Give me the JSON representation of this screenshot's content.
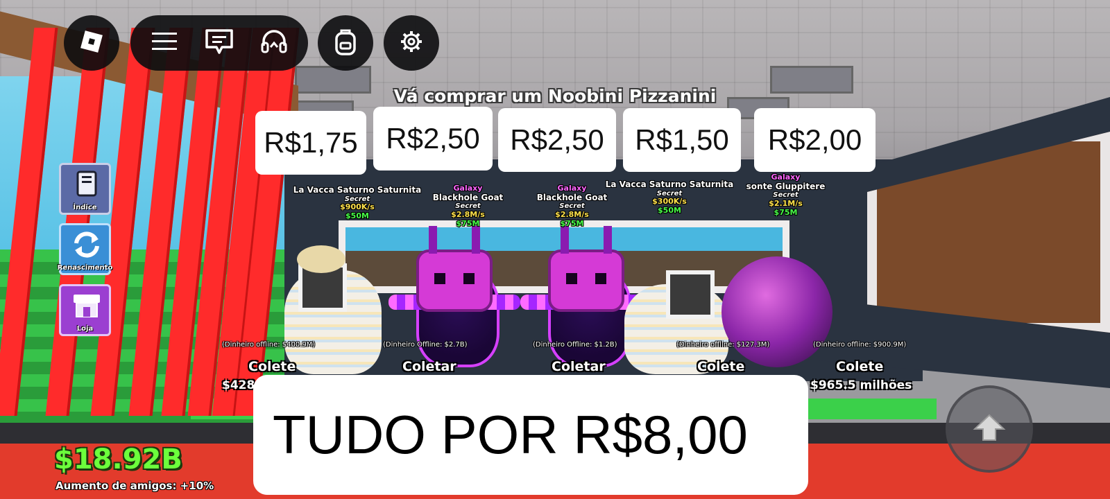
{
  "topbar": {
    "icons": [
      "roblox-logo-icon",
      "menu-icon",
      "chat-icon",
      "voice-headset-icon",
      "backpack-icon",
      "settings-gear-icon"
    ]
  },
  "side_menu": [
    {
      "label": "Índice",
      "icon": "book-icon",
      "color": "#5b6aa6"
    },
    {
      "label": "Renascimento",
      "icon": "rebirth-arrows-icon",
      "color": "#3a8fd6"
    },
    {
      "label": "Loja",
      "icon": "shop-icon",
      "color": "#9b3fd1"
    }
  ],
  "quest_text": "Vá comprar um Noobini Pizzanini",
  "price_cards": [
    "R$1,75",
    "R$2,50",
    "R$2,50",
    "R$1,50",
    "R$2,00"
  ],
  "bundle_text": "TUDO POR R$8,00",
  "brainrots": [
    {
      "rarity": "",
      "name": "La Vacca Saturno Saturnita",
      "mutation": "Secret",
      "rate": "$900K/s",
      "price": "$50M",
      "offline": "(Dinheiro offline: $400.9M)",
      "collect": "Colete",
      "amount": "$428"
    },
    {
      "rarity": "Galaxy",
      "name": "Blackhole Goat",
      "mutation": "Secret",
      "rate": "$2.8M/s",
      "price": "$75M",
      "offline": "(Dinheiro Offline: $2.7B)",
      "collect": "Coletar",
      "amount": ""
    },
    {
      "rarity": "Galaxy",
      "name": "Blackhole Goat",
      "mutation": "Secret",
      "rate": "$2.8M/s",
      "price": "$75M",
      "offline": "(Dinheiro Offline: $1.2B)",
      "collect": "Coletar",
      "amount": ""
    },
    {
      "rarity": "",
      "name": "La Vacca Saturno Saturnita",
      "mutation": "Secret",
      "rate": "$300K/s",
      "price": "$50M",
      "offline": "(Dinheiro offline: $127.3M)",
      "collect": "Colete",
      "amount": ""
    },
    {
      "rarity": "Galaxy",
      "name": "sonte Gluppitere",
      "mutation": "Secret",
      "rate": "$2.1M/s",
      "price": "$75M",
      "offline": "(Dinheiro offline: $900.9M)",
      "collect": "Colete",
      "amount": "$965.5 milhões"
    }
  ],
  "player": {
    "money": "$18.92B",
    "friend_boost": "Aumento de amigos: +10%"
  },
  "controls": {
    "jump_icon": "jump-arrow-icon"
  },
  "colors": {
    "money_green": "#6cff3c",
    "floor_red": "#e23b2c",
    "galaxy_purple": "#d53ad6"
  }
}
